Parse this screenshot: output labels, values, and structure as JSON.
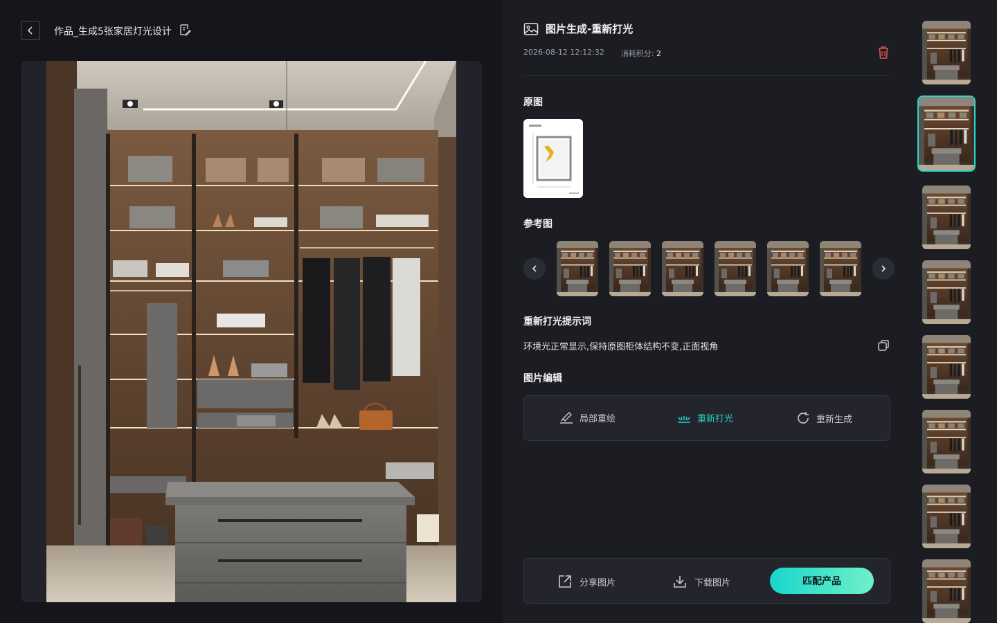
{
  "header": {
    "back_icon": "chevron-left-icon",
    "work_title": "作品_生成5张家居灯光设计",
    "edit_icon": "edit-document-icon"
  },
  "detail": {
    "title_icon": "image-icon",
    "title": "图片生成-重新打光",
    "timestamp": "2026-08-12 12:12:32",
    "points_label": "消耗积分:",
    "points_value": "2",
    "delete_icon": "trash-icon"
  },
  "sections": {
    "original": "原图",
    "reference": "参考图",
    "prompt": "重新打光提示词",
    "edit": "图片编辑"
  },
  "reference": {
    "prev_icon": "chevron-left-icon",
    "next_icon": "chevron-right-icon",
    "count": 6
  },
  "prompt_text": "环境光正常显示,保持原图柜体结构不变,正面视角",
  "copy_icon": "copy-icon",
  "edit_options": [
    {
      "label": "局部重绘",
      "icon": "brush-icon",
      "active": false
    },
    {
      "label": "重新打光",
      "icon": "light-icon",
      "active": true
    },
    {
      "label": "重新生成",
      "icon": "refresh-icon",
      "active": false
    }
  ],
  "actions": {
    "share": "分享图片",
    "share_icon": "share-icon",
    "download": "下载图片",
    "download_icon": "download-icon",
    "match": "匹配产品"
  },
  "rail": {
    "count": 8,
    "selected_index": 1
  },
  "colors": {
    "accent": "#22d3c5",
    "background": "#15161b",
    "panel": "#1c1d22",
    "danger": "#e0524f"
  }
}
